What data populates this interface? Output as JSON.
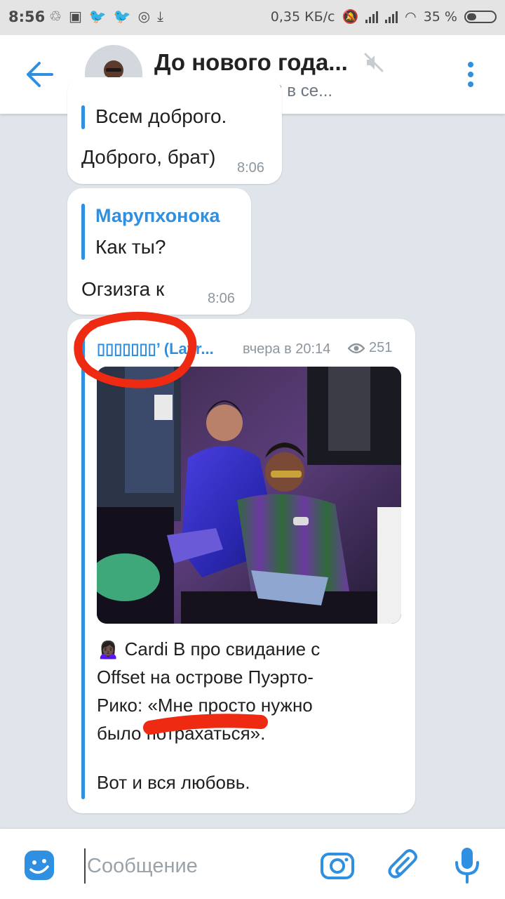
{
  "status_bar": {
    "time": "8:56",
    "speed": "0,35 КБ/с",
    "battery_percent": "35 %",
    "battery_level": 0.35
  },
  "header": {
    "title": "До нового года...",
    "subtitle": "11 участников, 2 в се..."
  },
  "messages": [
    {
      "quote_text": "Всем доброго.",
      "text": "Доброго, брат)",
      "time": "8:06"
    },
    {
      "quote_name": "Марупхонока",
      "quote_text": "Как ты?",
      "text": "Огзизга к",
      "time": "8:06"
    }
  ],
  "forward": {
    "name": "▯▯▯▯▯▯▯’ (Lavr...",
    "date": "вчера в 20:14",
    "views": "251",
    "text_lines": [
      "🙍🏿‍♀️ Cardi B про свидание с",
      "Offset на острове Пуэрто-",
      "Рико: «Мне просто нужно",
      "было потрахаться».",
      "",
      "Вот и вся любовь."
    ]
  },
  "input": {
    "placeholder": "Сообщение"
  },
  "colors": {
    "accent": "#2f8fe0",
    "chat_background": "#dfe5ea",
    "annotation_red": "#ee2a12"
  }
}
